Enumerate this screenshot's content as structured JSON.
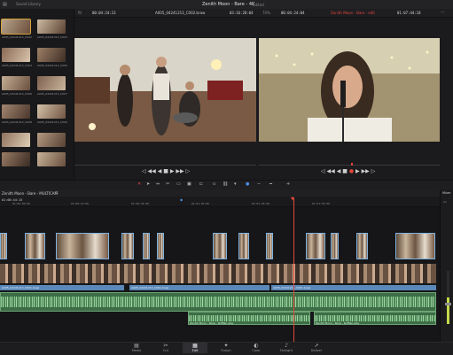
{
  "topbar": {
    "media_pool_label": "Sound Library",
    "project_title": "Zenith Moon - Bare - 4K",
    "status": "Edited"
  },
  "viewer_header": {
    "src_zoom": "fit",
    "src_timecode": "00:04:24:23",
    "clip_name": "A005_04241213_C002.braw",
    "src_duration": "03:16:28:04",
    "zoom": "70%",
    "timeline_timecode": "00:04:24:04",
    "timeline_name": "Zenith Moon - Bare - edit",
    "timeline_duration": "01:07:44:18"
  },
  "media_pool": {
    "labels": [
      "A005_04241213_C002",
      "A005_04241213_C003",
      "A005_04241213_C004",
      "A005_04241213_C005",
      "A005_04241213_C006",
      "A005_04241213_C007",
      "A005_04241213_C008",
      "A005_04241213_C009"
    ]
  },
  "transport": {
    "left": [
      "◁",
      "◀◀",
      "◀",
      "■",
      "▶",
      "▶▶",
      "▷"
    ],
    "right": [
      "◁",
      "◀◀",
      "◀",
      "■",
      "●",
      "▶",
      "▶▶",
      "▷"
    ]
  },
  "timeline": {
    "name": "Zenith Moon - Bare - MULTICAM",
    "timecode": "01:00:44:15",
    "ruler": [
      "01:00:00:00",
      "01:00:22:00",
      "01:00:44:00",
      "01:01:06:00",
      "01:01:28:00",
      "01:01:50:00"
    ],
    "clip_label_a": "A005_04241213_C001.braw",
    "clip_label_b": "A005_04241213_C001.braw",
    "clip_label_c": "A005_04241213_C001.braw",
    "audio_label_a": "Zenith Moon - Bare - Ruffian.wav",
    "audio_label_b": "Zenith Moon - Bare - Ruffian.wav"
  },
  "mixer": {
    "title": "Mixer",
    "channel": "A1"
  },
  "pages": [
    {
      "icon": "▤",
      "label": "Media"
    },
    {
      "icon": "✂",
      "label": "Cut"
    },
    {
      "icon": "▦",
      "label": "Edit"
    },
    {
      "icon": "✦",
      "label": "Fusion"
    },
    {
      "icon": "◐",
      "label": "Color"
    },
    {
      "icon": "♪",
      "label": "Fairlight"
    },
    {
      "icon": "➚",
      "label": "Deliver"
    }
  ],
  "colors": {
    "accent_red": "#e0463a",
    "video_clip": "#2e5e8f",
    "audio_clip": "#3c6d46"
  }
}
